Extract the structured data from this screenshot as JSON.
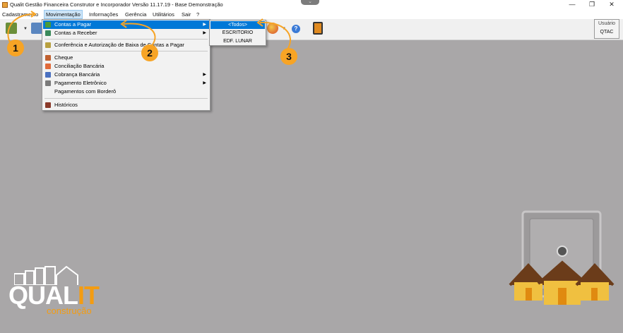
{
  "window": {
    "title": "Qualit Gestão Financeira Construtor e Incorporador Versão 11.17.19 - Base Demonstração",
    "minimize": "—",
    "restore": "❐",
    "close": "✕",
    "top_tab": "⌄"
  },
  "menubar": {
    "items": [
      "Cadastramento",
      "Movimentação",
      "Informações",
      "Gerência",
      "Utilitários",
      "Sair",
      "?"
    ],
    "active_index": 1
  },
  "movimentacao_menu": {
    "items": [
      {
        "label": "Contas a Pagar",
        "submenu": true,
        "highlighted": true,
        "icon_color": "#4a9a3a"
      },
      {
        "label": "Contas a Receber",
        "submenu": true,
        "highlighted": false,
        "icon_color": "#3a8a5a"
      },
      {
        "label": "Conferência e Autorização de Baixa de Contas a Pagar",
        "submenu": false,
        "highlighted": false,
        "icon_color": "#b8a040"
      },
      {
        "label": "Cheque",
        "submenu": false,
        "highlighted": false,
        "icon_color": "#c06030"
      },
      {
        "label": "Conciliação Bancária",
        "submenu": false,
        "highlighted": false,
        "icon_color": "#e06a3a"
      },
      {
        "label": "Cobrança Bancária",
        "submenu": true,
        "highlighted": false,
        "icon_color": "#4a70c0"
      },
      {
        "label": "Pagamento Eletrônico",
        "submenu": true,
        "highlighted": false,
        "icon_color": "#7a7a7a"
      },
      {
        "label": "Pagamentos com Borderô",
        "submenu": false,
        "highlighted": false,
        "icon_color": ""
      },
      {
        "label": "Históricos",
        "submenu": false,
        "highlighted": false,
        "icon_color": "#8a3a2a"
      }
    ],
    "submenu_arrow": "▶"
  },
  "contas_a_pagar_submenu": {
    "items": [
      {
        "label": "<Todos>",
        "highlighted": true
      },
      {
        "label": "ESCRITORIO",
        "highlighted": false
      },
      {
        "label": "EDF. LUNAR",
        "highlighted": false
      }
    ]
  },
  "user_panel": {
    "label": "Usuário",
    "value": "QTAC"
  },
  "annotations": [
    {
      "number": "1"
    },
    {
      "number": "2"
    },
    {
      "number": "3"
    }
  ],
  "logo": {
    "main": "QUAL",
    "accent": "IT",
    "sub": "construção"
  },
  "colors": {
    "desktop": "#a9a7a8",
    "highlight": "#0078d7",
    "annotation": "#f7a425",
    "logo_accent": "#f39c12"
  },
  "icons": [
    "app-icon",
    "toolbar-user-icon",
    "toolbar-computer-icon",
    "toolbar-chart-icon",
    "help-icon",
    "exit-door-icon",
    "safe-icon",
    "house-icon"
  ]
}
